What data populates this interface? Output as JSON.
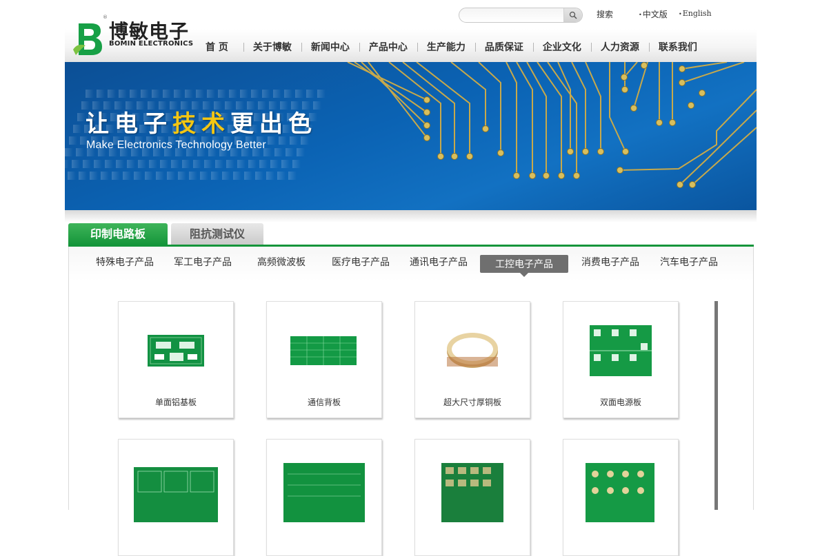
{
  "header": {
    "search_placeholder": "",
    "search_label": "搜索",
    "lang_cn": "中文版",
    "lang_en": "English",
    "logo_cn": "博敏电子",
    "logo_en": "BOMIN ELECTRONICS",
    "logo_mark": "B"
  },
  "nav": {
    "items": [
      "首 页",
      "关于博敏",
      "新闻中心",
      "产品中心",
      "生产能力",
      "品质保证",
      "企业文化",
      "人力资源",
      "联系我们"
    ]
  },
  "banner": {
    "title_part1": "让电子",
    "title_highlight": "技术",
    "title_part2": "更出色",
    "subtitle": "Make Electronics Technology Better"
  },
  "tabs": {
    "active": "印制电路板",
    "inactive": "阻抗测试仪"
  },
  "subcategories": {
    "items": [
      "特殊电子产品",
      "军工电子产品",
      "高频微波板",
      "医疗电子产品",
      "通讯电子产品",
      "工控电子产品",
      "消费电子产品",
      "汽车电子产品"
    ],
    "active_index": 5
  },
  "products": [
    {
      "name": "单面铝基板"
    },
    {
      "name": "通信背板"
    },
    {
      "name": "超大尺寸厚铜板"
    },
    {
      "name": "双面电源板"
    },
    {
      "name": ""
    },
    {
      "name": ""
    },
    {
      "name": ""
    },
    {
      "name": ""
    }
  ],
  "colors": {
    "brand_green": "#14953a",
    "banner_blue": "#0b63b4",
    "banner_highlight": "#f3c613",
    "active_subcat_bg": "#6f6f6f"
  },
  "icons": {
    "search": "magnifier-icon",
    "logo": "bomin-logo-icon"
  }
}
